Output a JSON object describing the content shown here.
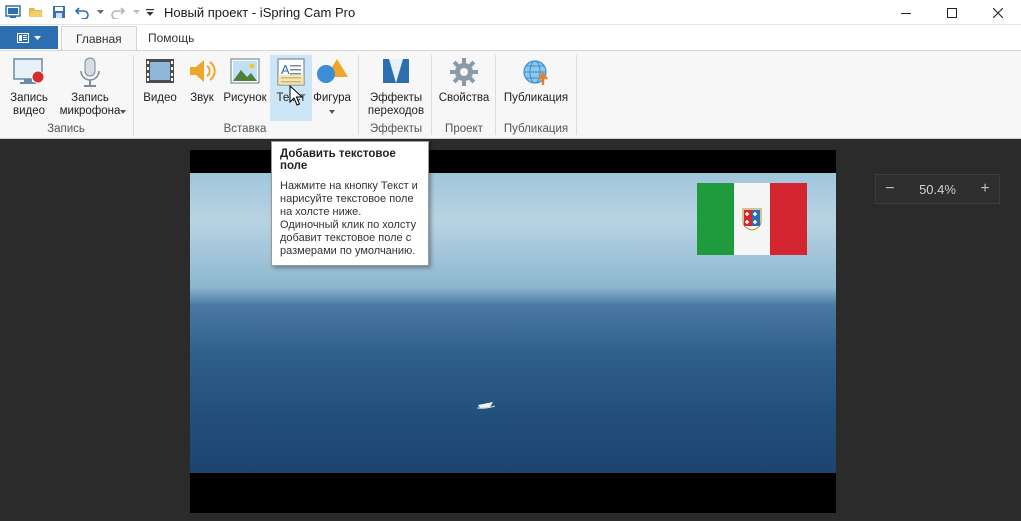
{
  "window": {
    "title": "Новый проект - iSpring Cam Pro",
    "controls": {
      "minimize": "minimize-icon",
      "maximize": "maximize-icon",
      "close": "close-icon"
    }
  },
  "quick_access": [
    "app-icon",
    "open-folder-icon",
    "save-icon",
    "undo-icon",
    "dropdown-arrow-icon",
    "redo-icon",
    "dropdown-arrow-icon",
    "customize-icon"
  ],
  "tabs": [
    {
      "label": "Главная",
      "active": true
    },
    {
      "label": "Помощь",
      "active": false
    }
  ],
  "ribbon": {
    "groups": {
      "record": "Запись",
      "insert": "Вставка",
      "effects": "Эффекты",
      "project": "Проект",
      "publish": "Публикация"
    },
    "buttons": {
      "record_video": "Запись\nвидео",
      "record_mic": "Запись\nмикрофона",
      "video": "Видео",
      "sound": "Звук",
      "picture": "Рисунок",
      "text": "Текст",
      "shape": "Фигура",
      "transitions": "Эффекты\nпереходов",
      "properties": "Свойства",
      "publish": "Публикация"
    }
  },
  "tooltip": {
    "title": "Добавить текстовое поле",
    "body": "Нажмите на кнопку Текст и нарисуйте текстовое поле на холсте ниже. Одиночный клик по холсту добавит текстовое поле с размерами по умолчанию."
  },
  "zoom": {
    "minus": "−",
    "value": "50.4%",
    "plus": "+"
  },
  "colors": {
    "accent": "#2c6fb0",
    "hover": "#cde6f7",
    "workspace": "#2b2b2b"
  }
}
